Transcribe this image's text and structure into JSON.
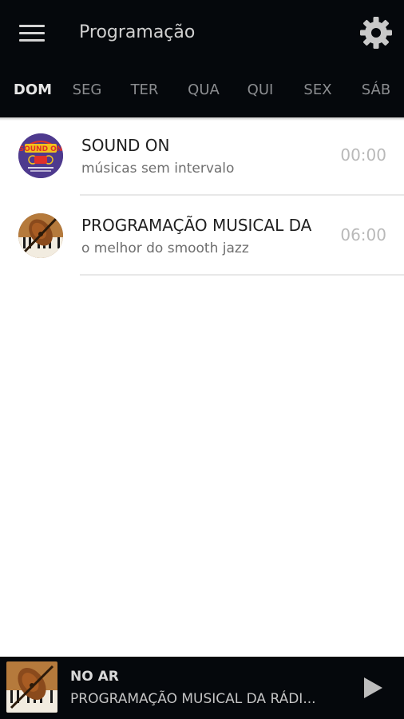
{
  "header": {
    "title": "Programação",
    "menu_icon": "hamburger-menu-icon",
    "settings_icon": "gear-icon"
  },
  "tabs": [
    {
      "label": "DOM",
      "active": true
    },
    {
      "label": "SEG",
      "active": false
    },
    {
      "label": "TER",
      "active": false
    },
    {
      "label": "QUA",
      "active": false
    },
    {
      "label": "QUI",
      "active": false
    },
    {
      "label": "SEX",
      "active": false
    },
    {
      "label": "SÁB",
      "active": false
    }
  ],
  "schedule": [
    {
      "name": "SOUND ON",
      "description": "músicas sem intervalo",
      "time": "00:00",
      "logo_text": "SOUND ON"
    },
    {
      "name": "PROGRAMAÇÃO MUSICAL DA",
      "description": "o melhor do smooth jazz",
      "time": "06:00"
    }
  ],
  "player": {
    "label": "NO AR",
    "track": "PROGRAMAÇÃO MUSICAL DA RÁDI...",
    "play_icon": "play-icon"
  },
  "colors": {
    "app_bar": "#05080c",
    "tab_active": "#e6e6e6",
    "tab_inactive": "#8b8d90",
    "logo_purple": "#4e3a8e",
    "logo_red": "#e0302a",
    "logo_yellow": "#f3c21b"
  }
}
